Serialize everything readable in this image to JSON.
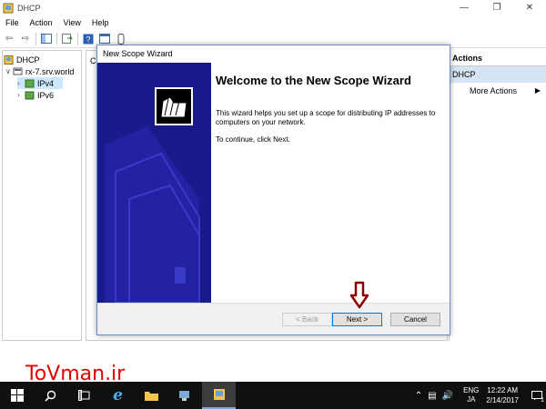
{
  "window": {
    "title": "DHCP"
  },
  "menu": [
    "File",
    "Action",
    "View",
    "Help"
  ],
  "tree": {
    "root": "DHCP",
    "server": "rx-7.srv.world",
    "ipv4": "IPv4",
    "ipv6": "IPv6"
  },
  "center": {
    "header_partial": "C"
  },
  "actions": {
    "header": "Actions",
    "section": "DHCP",
    "more": "More Actions"
  },
  "wizard": {
    "title": "New Scope Wizard",
    "heading": "Welcome to the New Scope Wizard",
    "p1": "This wizard helps you set up a scope for distributing IP addresses to computers on your network.",
    "p2": "To continue, click Next.",
    "back_label": "< Back",
    "next_label": "Next >",
    "cancel_label": "Cancel"
  },
  "watermark": "ToVman.ir",
  "taskbar": {
    "lang_top": "ENG",
    "lang_bottom": "JA",
    "time": "12:22 AM",
    "date": "2/14/2017",
    "notifications_count": "1"
  },
  "colors": {
    "banner": "#1a1a8a",
    "accent": "#0078d7",
    "watermark": "#e00000",
    "arrow": "#8b0000"
  }
}
